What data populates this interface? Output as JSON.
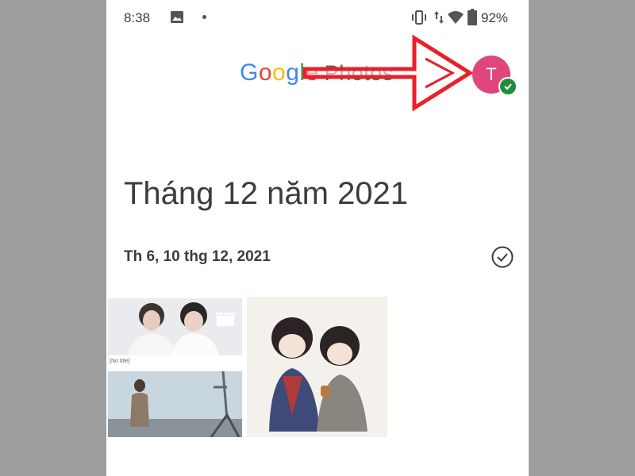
{
  "status_bar": {
    "time": "8:38",
    "battery": "92%"
  },
  "header": {
    "logo_letters": [
      "G",
      "o",
      "o",
      "g",
      "l",
      "e"
    ],
    "logo_product": "Photos",
    "avatar_initial": "T"
  },
  "section": {
    "month_title": "Tháng 12 năm 2021",
    "day_label": "Th 6, 10 thg 12, 2021"
  },
  "photos": [
    {
      "name": "couple-video",
      "caption": "[No title]",
      "is_video": true
    },
    {
      "name": "outdoor-photo"
    },
    {
      "name": "anime-illustration"
    }
  ],
  "colors": {
    "annotation_arrow": "#e8202a",
    "avatar": "#e0457b",
    "verified_badge": "#1e8e3e"
  }
}
